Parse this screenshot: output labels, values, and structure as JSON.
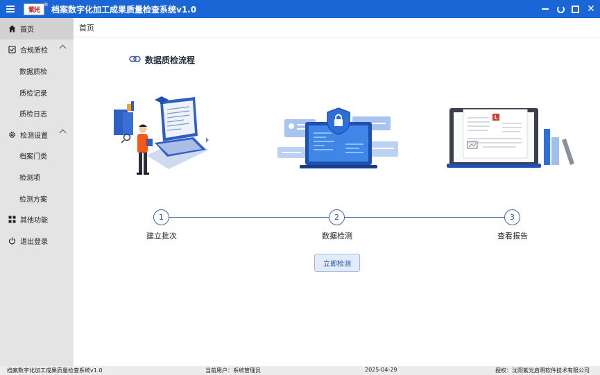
{
  "window": {
    "title": "档案数字化加工成果质量检查系统v1.0",
    "logo_text": "紫光",
    "logo_mark": "®"
  },
  "sidebar": {
    "items": [
      {
        "label": "首页",
        "icon": "home-icon"
      },
      {
        "label": "合规质检",
        "icon": "checklist-icon"
      },
      {
        "label": "数据质检"
      },
      {
        "label": "质检记录"
      },
      {
        "label": "质检日志"
      },
      {
        "label": "检测设置",
        "icon": "gear-icon"
      },
      {
        "label": "档案门类"
      },
      {
        "label": "检测项"
      },
      {
        "label": "检测方案"
      },
      {
        "label": "其他功能",
        "icon": "grid-icon"
      },
      {
        "label": "退出登录",
        "icon": "power-icon"
      }
    ]
  },
  "breadcrumb": {
    "current": "首页"
  },
  "main": {
    "section_title": "数据质检流程",
    "steps": [
      {
        "number": "1",
        "label": "建立批次"
      },
      {
        "number": "2",
        "label": "数据检测"
      },
      {
        "number": "3",
        "label": "查看报告"
      }
    ],
    "start_button": "立即检测",
    "report_badge": "L"
  },
  "statusbar": {
    "app_name": "档案数字化加工成果质量检查系统v1.0",
    "current_user": "当前用户：系统管理员",
    "date": "2025-04-29",
    "license": "授权：沈阳紫光启明软件技术有限公司"
  },
  "colors": {
    "titlebar": "#1a66d6",
    "accent": "#3b64b4",
    "sidebar_bg": "#e4e4e4"
  }
}
